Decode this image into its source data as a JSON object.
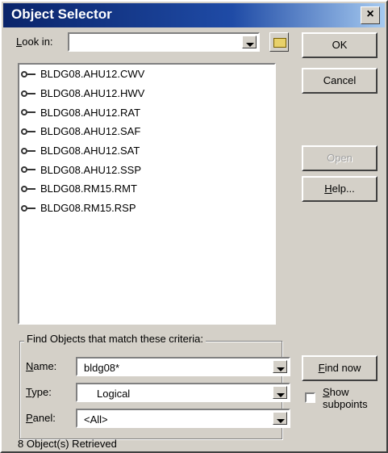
{
  "window": {
    "title": "Object Selector",
    "close_glyph": "×"
  },
  "lookin": {
    "label_u": "L",
    "label_rest": "ook in:",
    "value": ""
  },
  "buttons": {
    "ok": "OK",
    "cancel": "Cancel",
    "open": "Open",
    "help_u": "H",
    "help_rest": "elp...",
    "find_u": "F",
    "find_rest": "ind now"
  },
  "objects": [
    "BLDG08.AHU12.CWV",
    "BLDG08.AHU12.HWV",
    "BLDG08.AHU12.RAT",
    "BLDG08.AHU12.SAF",
    "BLDG08.AHU12.SAT",
    "BLDG08.AHU12.SSP",
    "BLDG08.RM15.RMT",
    "BLDG08.RM15.RSP"
  ],
  "criteria": {
    "group_title": "Find Objects that match these criteria:",
    "name_label_u": "N",
    "name_label_rest": "ame:",
    "name_value": "bldg08*",
    "type_label_u": "T",
    "type_label_rest": "ype:",
    "type_value": "Logical",
    "panel_label_u": "P",
    "panel_label_rest": "anel:",
    "panel_value": "<All>",
    "show_subpoints_u": "S",
    "show_subpoints_rest": "how",
    "show_subpoints_line2": "subpoints",
    "show_subpoints_checked": false
  },
  "status": "8 Object(s) Retrieved"
}
